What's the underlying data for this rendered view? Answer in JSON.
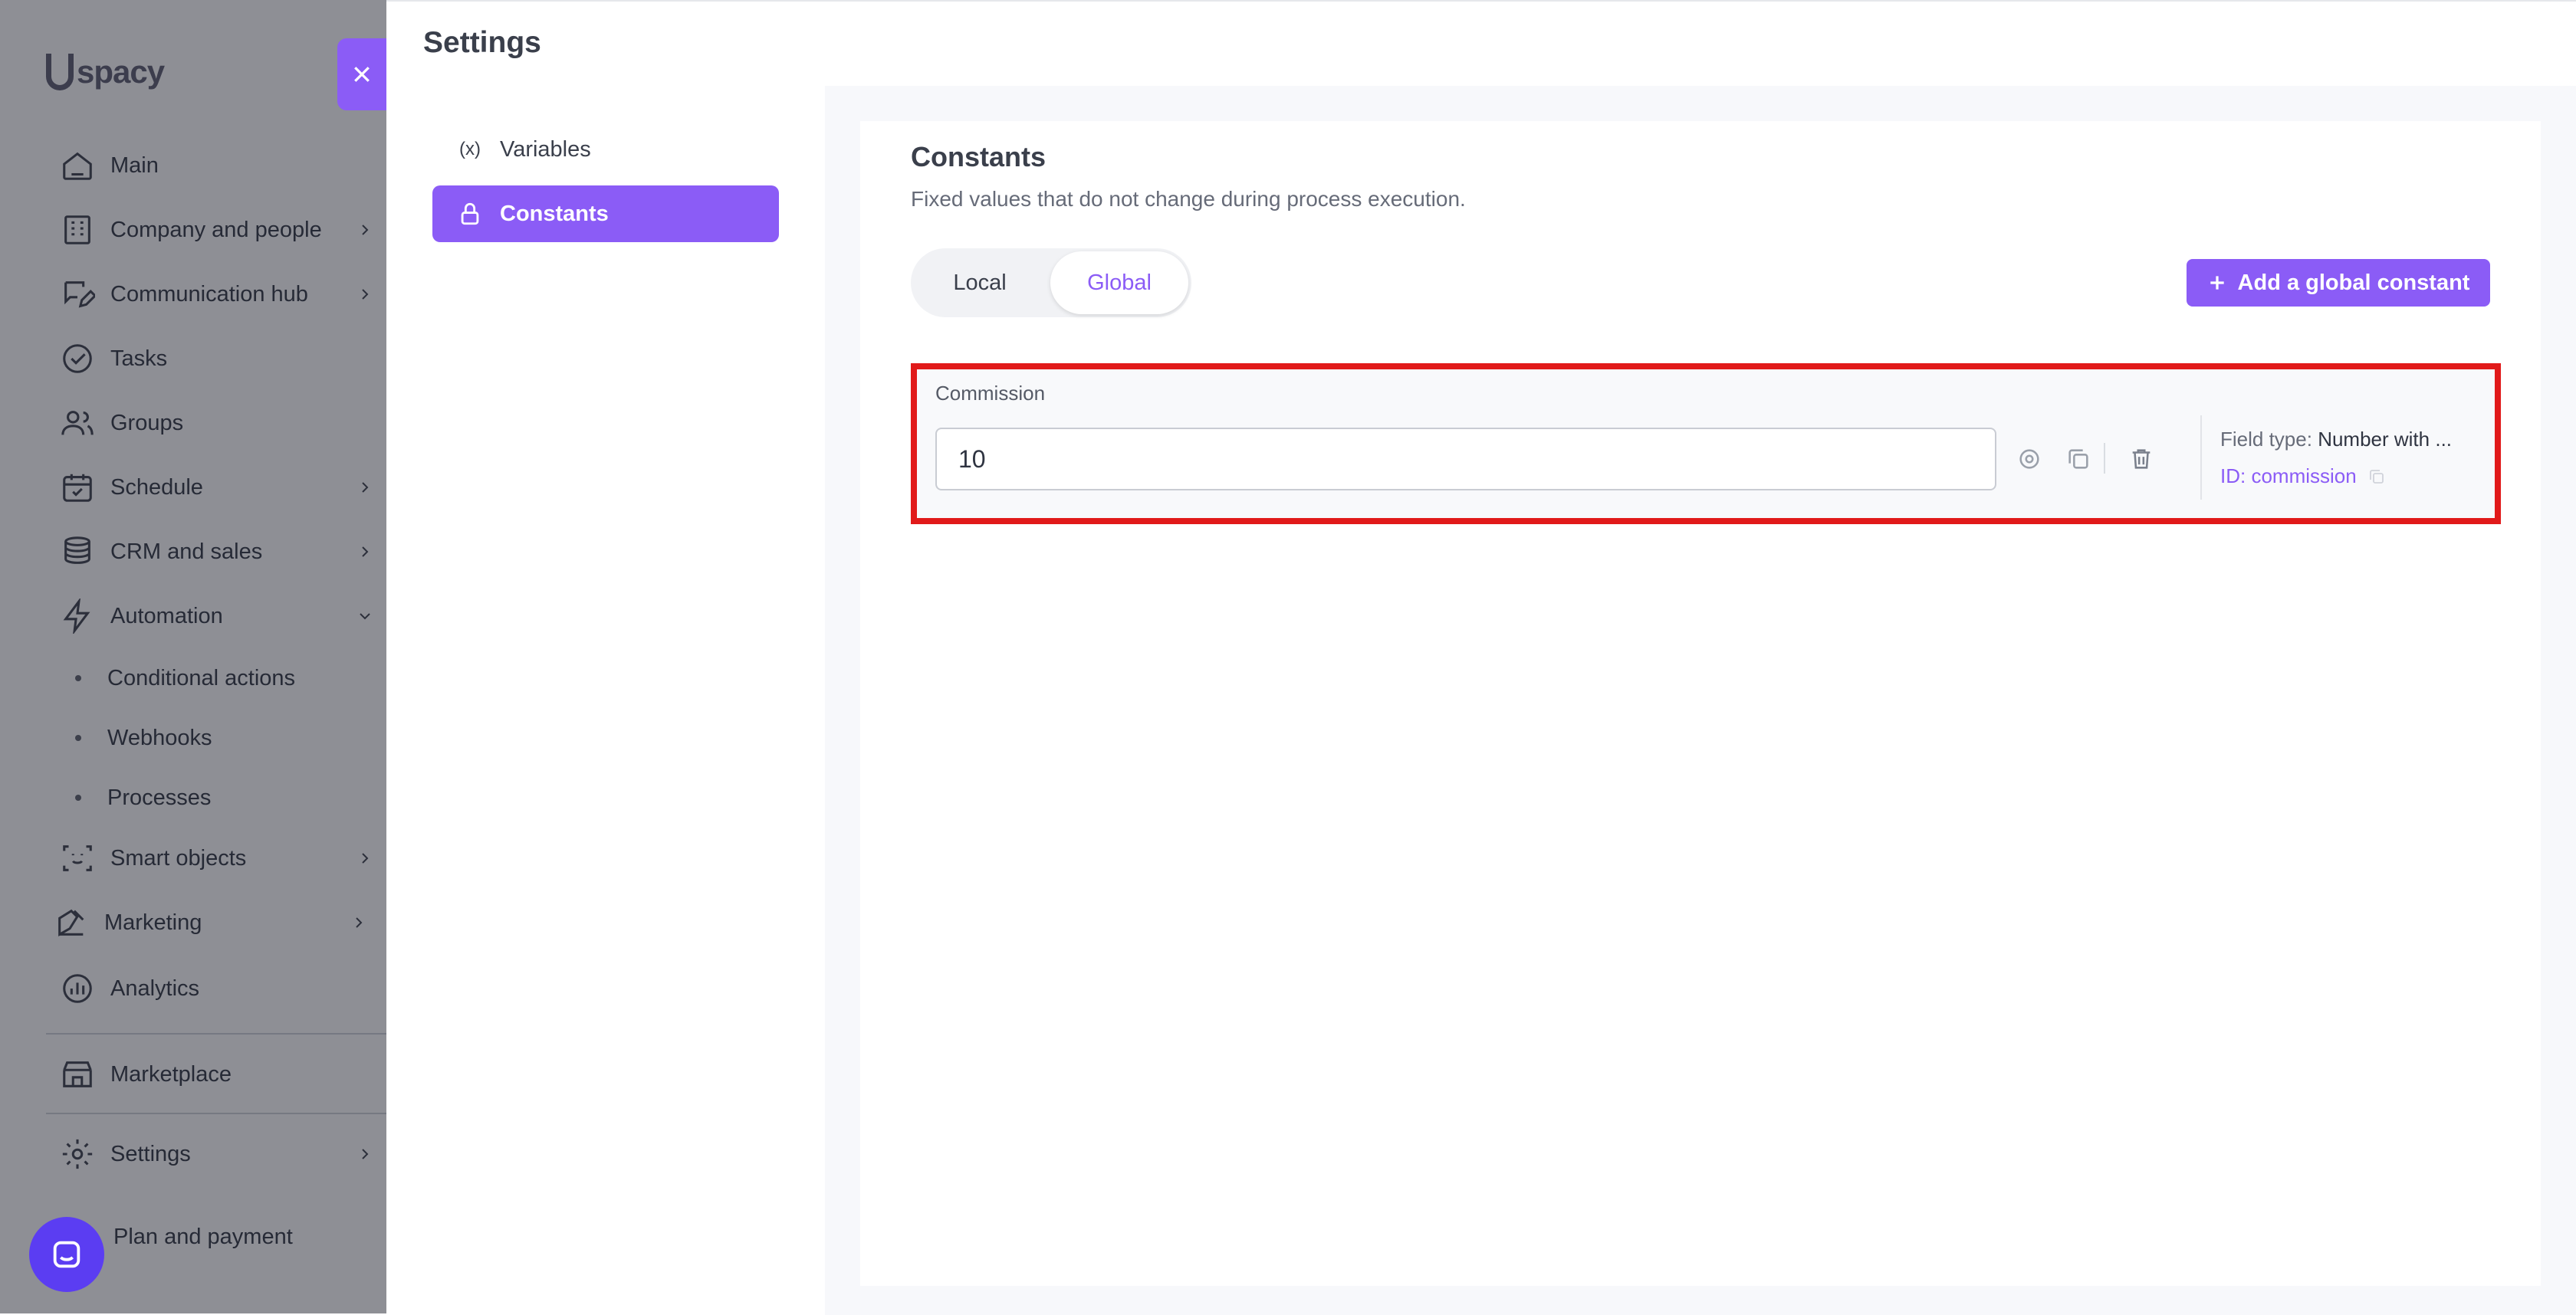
{
  "app": {
    "logo_text": "spacy",
    "nav": [
      {
        "label": "Main",
        "icon": "home-icon",
        "chevron": false
      },
      {
        "label": "Company and people",
        "icon": "building-icon",
        "chevron": true
      },
      {
        "label": "Communication hub",
        "icon": "chat-edit-icon",
        "chevron": true
      },
      {
        "label": "Tasks",
        "icon": "check-circle-icon",
        "chevron": false
      },
      {
        "label": "Groups",
        "icon": "users-icon",
        "chevron": false
      },
      {
        "label": "Schedule",
        "icon": "calendar-icon",
        "chevron": true
      },
      {
        "label": "CRM and sales",
        "icon": "coins-icon",
        "chevron": true
      },
      {
        "label": "Automation",
        "icon": "lightning-icon",
        "chevron": true
      }
    ],
    "automation_sub": [
      "Conditional actions",
      "Webhooks",
      "Processes"
    ],
    "nav2": [
      {
        "label": "Smart objects",
        "icon": "scan-face-icon",
        "chevron": true
      },
      {
        "label": "Marketing",
        "icon": "megaphone-icon",
        "chevron": true
      },
      {
        "label": "Analytics",
        "icon": "chart-icon",
        "chevron": false
      }
    ],
    "marketplace": "Marketplace",
    "settings": "Settings",
    "plan": "Plan and payment"
  },
  "panel": {
    "title": "Settings",
    "menu": [
      {
        "label": "Variables",
        "icon_text": "(x)"
      },
      {
        "label": "Constants",
        "icon": "lock-icon"
      }
    ]
  },
  "constants": {
    "title": "Constants",
    "description": "Fixed values that do not change during process execution.",
    "tabs": [
      "Local",
      "Global"
    ],
    "active_tab": "Global",
    "add_button": "Add a global constant",
    "items": [
      {
        "label": "Commission",
        "value": "10",
        "field_type_label": "Field type:",
        "field_type_value": "Number with ...",
        "id_text": "ID: commission"
      }
    ]
  },
  "colors": {
    "accent": "#8b5cf6",
    "highlight": "#e11a1a"
  }
}
